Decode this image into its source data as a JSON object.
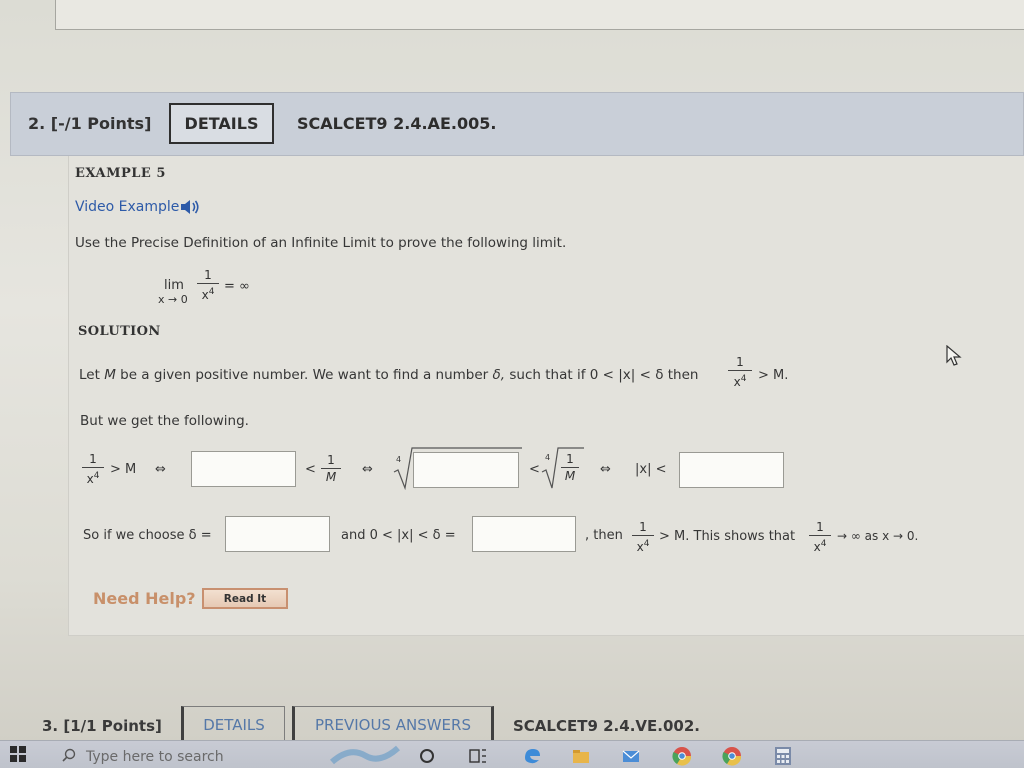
{
  "question2": {
    "number": "2.",
    "points": "[-/1 Points]",
    "details_label": "DETAILS",
    "code": "SCALCET9 2.4.AE.005."
  },
  "example": {
    "title": "EXAMPLE 5",
    "video_link": "Video Example",
    "instruction": "Use the Precise Definition of an Infinite Limit to prove the following limit."
  },
  "limit": {
    "lim": "lim",
    "sub": "x → 0",
    "num": "1",
    "den_base": "x",
    "den_exp": "4",
    "equals": "= ∞"
  },
  "solution": {
    "title": "SOLUTION",
    "intro_pre": "Let",
    "intro_M": "M",
    "intro_mid": "be a given positive number. We want to find a number",
    "intro_delta": "δ,",
    "intro_post": "such that if 0 < |x| < δ then",
    "intro_end": "> M.",
    "but_text": "But we get the following.",
    "row1_gt_M": "> M",
    "iff": "⇔",
    "lt": "<",
    "one": "1",
    "M": "M",
    "root_index": "4",
    "abs_x_lt": "|x| <",
    "so_choose": "So if we choose δ =",
    "and_text": "and 0 < |x| < δ =",
    "then_text": ", then",
    "gt_M_shows": "> M. This shows that",
    "conclusion": "→ ∞ as x → 0."
  },
  "inputs": {
    "box1": "",
    "box2": "",
    "box3": "",
    "delta1": "",
    "delta2": ""
  },
  "help": {
    "need_help": "Need Help?",
    "read_it": "Read It"
  },
  "question3": {
    "points": "3. [1/1 Points]",
    "details_label": "DETAILS",
    "previous_answers": "PREVIOUS ANSWERS",
    "code": "SCALCET9 2.4.VE.002."
  },
  "taskbar": {
    "search_placeholder": "Type here to search"
  },
  "colors": {
    "link": "#2d5aa8",
    "header_bg": "#c9cfd8",
    "need_help": "#c8906a"
  }
}
